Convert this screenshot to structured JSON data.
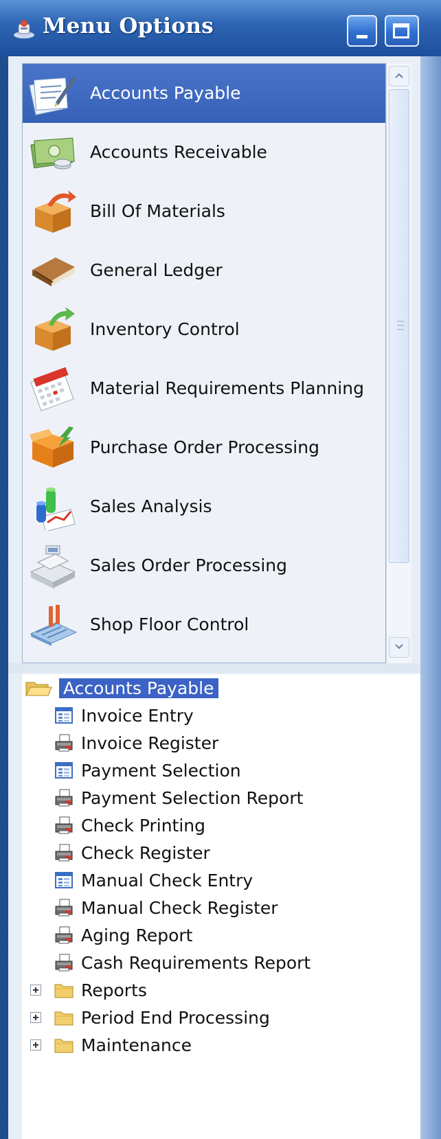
{
  "window": {
    "title": "Menu Options"
  },
  "menu": {
    "items": [
      {
        "label": "Accounts Payable",
        "icon": "accounts-payable-icon",
        "selected": true
      },
      {
        "label": "Accounts Receivable",
        "icon": "money-icon",
        "selected": false
      },
      {
        "label": "Bill Of Materials",
        "icon": "box-arrow-icon",
        "selected": false
      },
      {
        "label": "General Ledger",
        "icon": "ledger-book-icon",
        "selected": false
      },
      {
        "label": "Inventory Control",
        "icon": "box-green-arrow-icon",
        "selected": false
      },
      {
        "label": "Material Requirements Planning",
        "icon": "calendar-icon",
        "selected": false
      },
      {
        "label": "Purchase Order Processing",
        "icon": "box-inbound-icon",
        "selected": false
      },
      {
        "label": "Sales Analysis",
        "icon": "chart-icon",
        "selected": false
      },
      {
        "label": "Sales Order Processing",
        "icon": "cash-register-icon",
        "selected": false
      },
      {
        "label": "Shop Floor Control",
        "icon": "factory-icon",
        "selected": false
      }
    ]
  },
  "tree": {
    "root": {
      "label": "Accounts Payable",
      "icon": "folder-open-icon"
    },
    "tasks": [
      {
        "label": "Invoice Entry",
        "icon": "form-icon"
      },
      {
        "label": "Invoice Register",
        "icon": "printer-icon"
      },
      {
        "label": "Payment Selection",
        "icon": "form-icon"
      },
      {
        "label": "Payment Selection Report",
        "icon": "printer-icon"
      },
      {
        "label": "Check Printing",
        "icon": "printer-icon"
      },
      {
        "label": "Check Register",
        "icon": "printer-icon"
      },
      {
        "label": "Manual Check Entry",
        "icon": "form-icon"
      },
      {
        "label": "Manual Check Register",
        "icon": "printer-icon"
      },
      {
        "label": "Aging Report",
        "icon": "printer-icon"
      },
      {
        "label": "Cash Requirements Report",
        "icon": "printer-icon"
      }
    ],
    "folders": [
      {
        "label": "Reports",
        "icon": "folder-icon"
      },
      {
        "label": "Period End Processing",
        "icon": "folder-icon"
      },
      {
        "label": "Maintenance",
        "icon": "folder-icon"
      }
    ]
  },
  "colors": {
    "selection": "#3561b7",
    "titlebar": "#2f66b5"
  }
}
